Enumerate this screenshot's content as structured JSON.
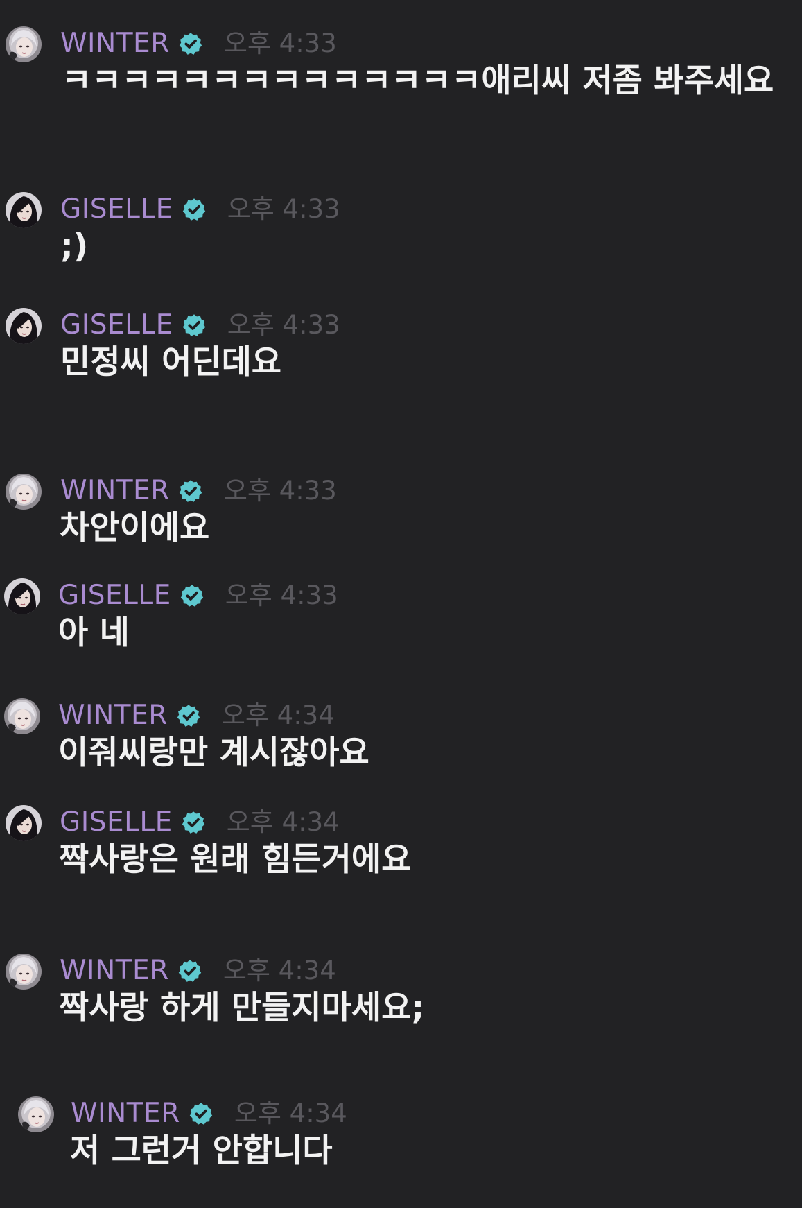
{
  "messages": [
    {
      "user": "WINTER",
      "time": "오후 4:33",
      "text": "ㅋㅋㅋㅋㅋㅋㅋㅋㅋㅋㅋㅋㅋㅋ애리씨 저좀 봐주세요",
      "avatar": "winter-avatar",
      "verified": "verified-icon"
    },
    {
      "user": "GISELLE",
      "time": "오후 4:33",
      "text": ";)",
      "avatar": "giselle-avatar",
      "verified": "verified-icon"
    },
    {
      "user": "GISELLE",
      "time": "오후 4:33",
      "text": "민정씨 어딘데요",
      "avatar": "giselle-avatar",
      "verified": "verified-icon"
    },
    {
      "user": "WINTER",
      "time": "오후 4:33",
      "text": "차안이에요",
      "avatar": "winter-avatar",
      "verified": "verified-icon"
    },
    {
      "user": "GISELLE",
      "time": "오후 4:33",
      "text": "아 네",
      "avatar": "giselle-avatar",
      "verified": "verified-icon"
    },
    {
      "user": "WINTER",
      "time": "오후 4:34",
      "text": "이줘씨랑만 계시잖아요",
      "avatar": "winter-avatar",
      "verified": "verified-icon"
    },
    {
      "user": "GISELLE",
      "time": "오후 4:34",
      "text": "짝사랑은 원래 힘든거에요",
      "avatar": "giselle-avatar",
      "verified": "verified-icon"
    },
    {
      "user": "WINTER",
      "time": "오후 4:34",
      "text": "짝사랑 하게 만들지마세요;",
      "avatar": "winter-avatar",
      "verified": "verified-icon"
    },
    {
      "user": "WINTER",
      "time": "오후 4:34",
      "text": "저 그런거 안합니다",
      "avatar": "winter-avatar",
      "verified": "verified-icon"
    }
  ],
  "colors": {
    "background": "#222224",
    "username": "#a98bd0",
    "timestamp": "#59585d",
    "message_text": "#f2f2f2",
    "verified_badge": "#5ec8cf"
  }
}
